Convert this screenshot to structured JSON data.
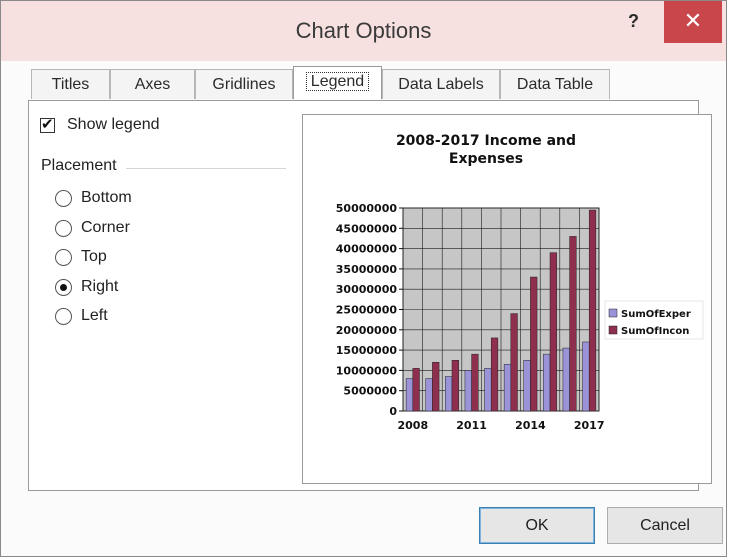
{
  "window": {
    "title": "Chart Options",
    "help": "?",
    "close": "✕"
  },
  "tabs": [
    {
      "label": "Titles"
    },
    {
      "label": "Axes"
    },
    {
      "label": "Gridlines"
    },
    {
      "label": "Legend",
      "active": true
    },
    {
      "label": "Data Labels"
    },
    {
      "label": "Data Table"
    }
  ],
  "legend_options": {
    "show_legend": {
      "label": "Show legend",
      "checked": true
    },
    "placement_label": "Placement",
    "placements": [
      {
        "label": "Bottom",
        "selected": false
      },
      {
        "label": "Corner",
        "selected": false
      },
      {
        "label": "Top",
        "selected": false
      },
      {
        "label": "Right",
        "selected": true
      },
      {
        "label": "Left",
        "selected": false
      }
    ]
  },
  "buttons": {
    "ok": "OK",
    "cancel": "Cancel"
  },
  "colors": {
    "expenses": "#9a93d8",
    "income": "#8e2f4e",
    "plot_bg": "#c6c6c6"
  },
  "chart_data": {
    "type": "bar",
    "title": "2008-2017 Income and Expenses",
    "categories": [
      "2008",
      "2009",
      "2010",
      "2011",
      "2012",
      "2013",
      "2014",
      "2015",
      "2016",
      "2017"
    ],
    "x_tick_labels": [
      "2008",
      "2011",
      "2014",
      "2017"
    ],
    "y_ticks": [
      "0",
      "5000000",
      "10000000",
      "15000000",
      "20000000",
      "25000000",
      "30000000",
      "35000000",
      "40000000",
      "45000000",
      "50000000"
    ],
    "ylim": [
      0,
      50000000
    ],
    "grid": true,
    "legend_position": "right",
    "series": [
      {
        "name": "SumOfExper",
        "color": "#9a93d8",
        "values": [
          8000000,
          8000000,
          8500000,
          10000000,
          10500000,
          11500000,
          12500000,
          14000000,
          15500000,
          17000000
        ]
      },
      {
        "name": "SumOfIncon",
        "color": "#8e2f4e",
        "values": [
          10500000,
          12000000,
          12500000,
          14000000,
          18000000,
          24000000,
          33000000,
          39000000,
          43000000,
          49500000
        ]
      }
    ]
  }
}
